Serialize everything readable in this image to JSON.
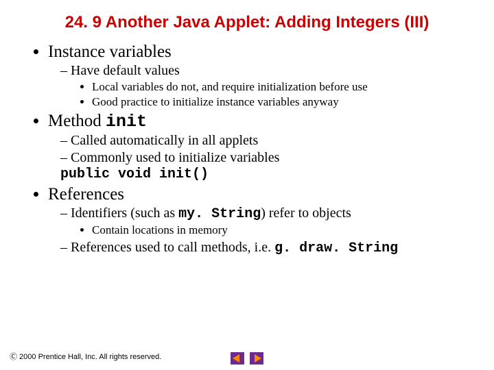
{
  "title": "24. 9  Another Java Applet: Adding Integers (III)",
  "b1": {
    "t": "Instance variables",
    "s1": "Have default values",
    "s1a": "Local variables do not, and require initialization before use",
    "s1b": "Good practice to initialize instance variables anyway"
  },
  "b2": {
    "t_pre": "Method ",
    "t_code": "init",
    "s1": "Called automatically in all applets",
    "s2": "Commonly used to initialize variables",
    "s2_code": "public void init()"
  },
  "b3": {
    "t": "References",
    "s1_pre": "Identifiers (such as ",
    "s1_code": "my. String",
    "s1_post": ") refer to objects",
    "s1a": "Contain locations in memory",
    "s2_pre": "References used to call methods, i.e. ",
    "s2_code": "g. draw. String"
  },
  "footer": "Ⓒ 2000 Prentice Hall, Inc.  All rights reserved."
}
